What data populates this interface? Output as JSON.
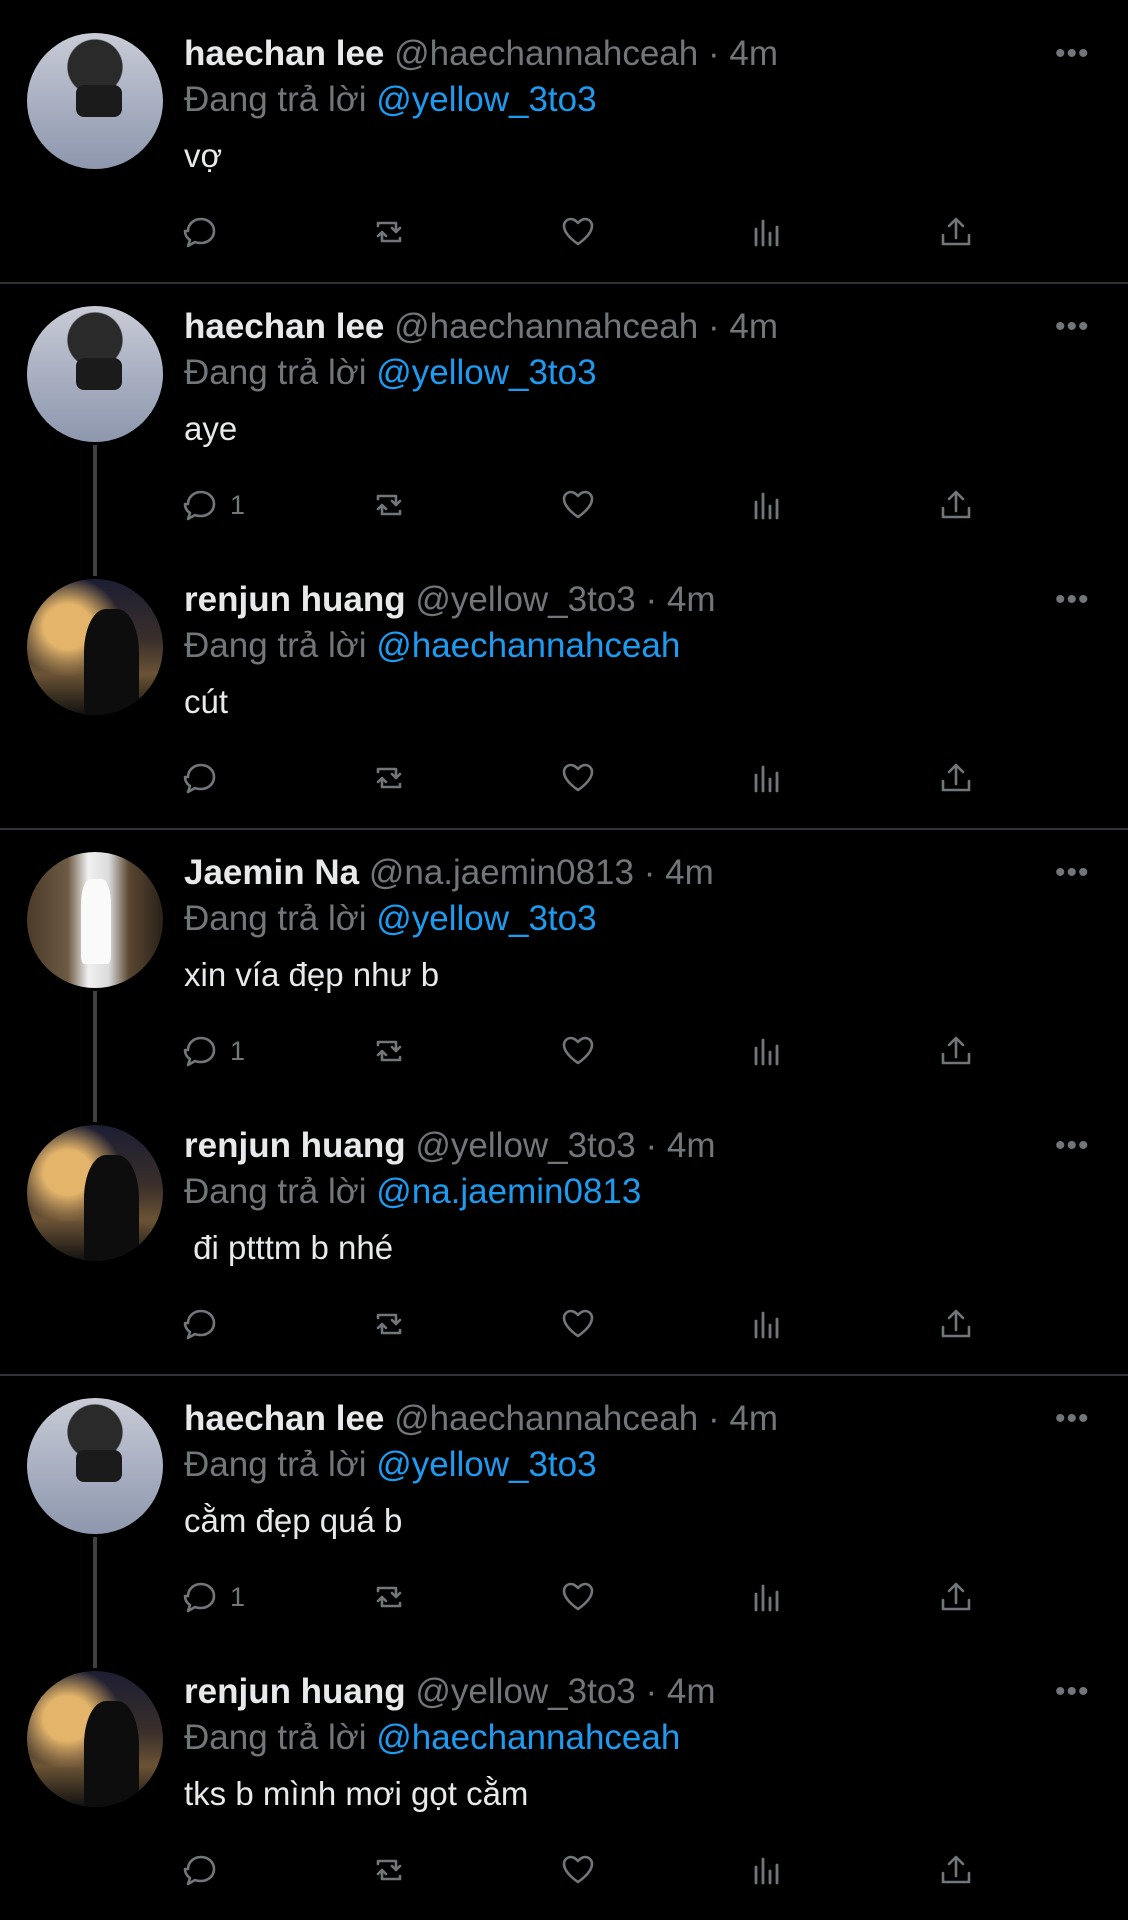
{
  "ui": {
    "more_label": "•••"
  },
  "tweets": [
    {
      "name": "haechan lee",
      "handle": "@haechannahceah",
      "separator": "·",
      "time": "4m",
      "reply_prefix": "Đang trả lời",
      "reply_to": "@yellow_3to3",
      "text": "vợ",
      "reply_count": "",
      "avatar": "haechan"
    },
    {
      "name": "haechan lee",
      "handle": "@haechannahceah",
      "separator": "·",
      "time": "4m",
      "reply_prefix": "Đang trả lời",
      "reply_to": "@yellow_3to3",
      "text": "aye",
      "reply_count": "1",
      "avatar": "haechan"
    },
    {
      "name": "renjun huang",
      "handle": "@yellow_3to3",
      "separator": "·",
      "time": "4m",
      "reply_prefix": "Đang trả lời",
      "reply_to": "@haechannahceah",
      "text": "cút",
      "reply_count": "",
      "avatar": "renjun"
    },
    {
      "name": "Jaemin Na",
      "handle": "@na.jaemin0813",
      "separator": "·",
      "time": "4m",
      "reply_prefix": "Đang trả lời",
      "reply_to": "@yellow_3to3",
      "text": "xin vía đẹp như b",
      "reply_count": "1",
      "avatar": "jaemin"
    },
    {
      "name": "renjun huang",
      "handle": "@yellow_3to3",
      "separator": "·",
      "time": "4m",
      "reply_prefix": "Đang trả lời",
      "reply_to": "@na.jaemin0813",
      "text": " đi ptttm b nhé",
      "reply_count": "",
      "avatar": "renjun"
    },
    {
      "name": "haechan lee",
      "handle": "@haechannahceah",
      "separator": "·",
      "time": "4m",
      "reply_prefix": "Đang trả lời",
      "reply_to": "@yellow_3to3",
      "text": "cằm đẹp quá b",
      "reply_count": "1",
      "avatar": "haechan"
    },
    {
      "name": "renjun huang",
      "handle": "@yellow_3to3",
      "separator": "·",
      "time": "4m",
      "reply_prefix": "Đang trả lời",
      "reply_to": "@haechannahceah",
      "text": "tks b mình mơi gọt cằm",
      "reply_count": "",
      "avatar": "renjun"
    }
  ]
}
